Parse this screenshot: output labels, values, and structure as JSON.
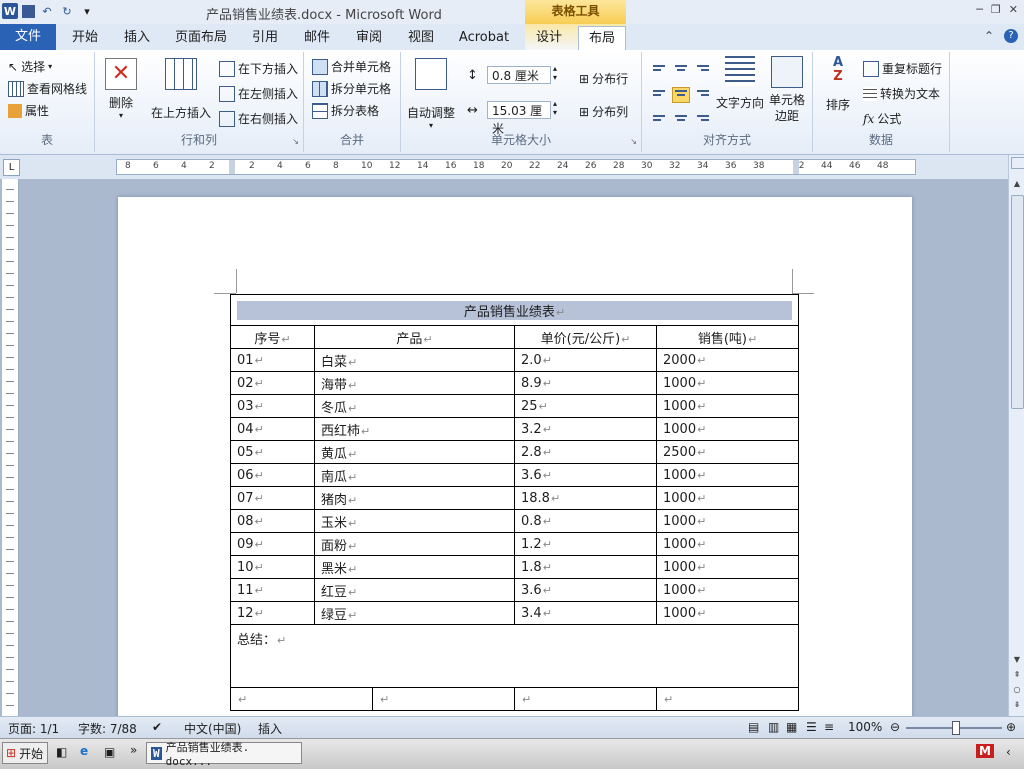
{
  "titlebar": {
    "title": "产品销售业绩表.docx  -  Microsoft Word",
    "context_tab_group": "表格工具"
  },
  "tabs": [
    "文件",
    "开始",
    "插入",
    "页面布局",
    "引用",
    "邮件",
    "审阅",
    "视图",
    "Acrobat",
    "设计",
    "布局"
  ],
  "ribbon": {
    "table_group": {
      "label": "表",
      "select": "选择",
      "gridlines": "查看网格线",
      "properties": "属性"
    },
    "rowscols_group": {
      "label": "行和列",
      "delete": "删除",
      "insert_above": "在上方插入",
      "insert_below": "在下方插入",
      "insert_left": "在左侧插入",
      "insert_right": "在右侧插入"
    },
    "merge_group": {
      "label": "合并",
      "merge_cells": "合并单元格",
      "split_cells": "拆分单元格",
      "split_table": "拆分表格"
    },
    "cellsize_group": {
      "label": "单元格大小",
      "autofit": "自动调整",
      "height": "0.8 厘米",
      "width": "15.03 厘米",
      "dist_rows": "分布行",
      "dist_cols": "分布列"
    },
    "align_group": {
      "label": "对齐方式",
      "text_dir": "文字方向",
      "margins": "单元格边距"
    },
    "data_group": {
      "label": "数据",
      "sort": "排序",
      "repeat_header": "重复标题行",
      "to_text": "转换为文本",
      "formula": "公式"
    }
  },
  "ruler_ticks": [
    "8",
    "6",
    "4",
    "2",
    "2",
    "4",
    "6",
    "8",
    "10",
    "12",
    "14",
    "16",
    "18",
    "20",
    "22",
    "24",
    "26",
    "28",
    "30",
    "32",
    "34",
    "36",
    "38",
    "42",
    "44",
    "46",
    "48"
  ],
  "table": {
    "title": "产品销售业绩表",
    "headers": [
      "序号",
      "产品",
      "单价(元/公斤)",
      "销售(吨)"
    ],
    "rows": [
      [
        "01",
        "白菜",
        "2.0",
        "2000"
      ],
      [
        "02",
        "海带",
        "8.9",
        "1000"
      ],
      [
        "03",
        "冬瓜",
        "25",
        "1000"
      ],
      [
        "04",
        "西红柿",
        "3.2",
        "1000"
      ],
      [
        "05",
        "黄瓜",
        "2.8",
        "2500"
      ],
      [
        "06",
        "南瓜",
        "3.6",
        "1000"
      ],
      [
        "07",
        "猪肉",
        "18.8",
        "1000"
      ],
      [
        "08",
        "玉米",
        "0.8",
        "1000"
      ],
      [
        "09",
        "面粉",
        "1.2",
        "1000"
      ],
      [
        "10",
        "黑米",
        "1.8",
        "1000"
      ],
      [
        "11",
        "红豆",
        "3.6",
        "1000"
      ],
      [
        "12",
        "绿豆",
        "3.4",
        "1000"
      ]
    ],
    "summary_label": "总结："
  },
  "status": {
    "page": "页面: 1/1",
    "words": "字数: 7/88",
    "language": "中文(中国)",
    "mode": "插入",
    "zoom": "100%"
  },
  "taskbar": {
    "start": "开始",
    "item": "产品销售业绩表. docx..."
  }
}
